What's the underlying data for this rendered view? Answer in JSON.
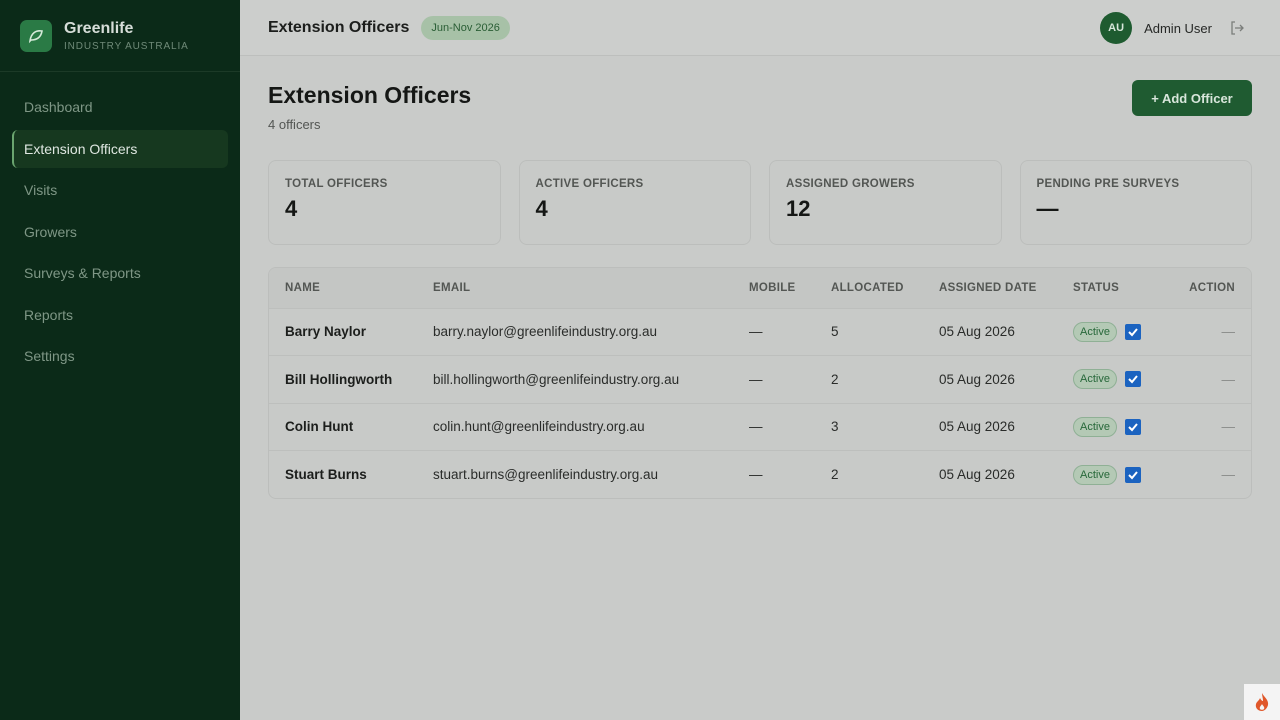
{
  "brand": {
    "name": "Greenlife",
    "subtitle": "INDUSTRY AUSTRALIA"
  },
  "sidebar": {
    "items": [
      {
        "label": "Dashboard"
      },
      {
        "label": "Extension Officers"
      },
      {
        "label": "Visits"
      },
      {
        "label": "Growers"
      },
      {
        "label": "Surveys & Reports"
      },
      {
        "label": "Reports"
      },
      {
        "label": "Settings"
      }
    ]
  },
  "header": {
    "title": "Extension Officers",
    "season": "Jun-Nov 2026"
  },
  "user": {
    "initials": "AU",
    "name": "Admin User"
  },
  "page": {
    "title": "Extension Officers",
    "subtitle": "4 officers",
    "add_button": "+ Add Officer"
  },
  "stats": [
    {
      "label": "TOTAL OFFICERS",
      "value": "4"
    },
    {
      "label": "ACTIVE OFFICERS",
      "value": "4"
    },
    {
      "label": "ASSIGNED GROWERS",
      "value": "12"
    },
    {
      "label": "PENDING PRE SURVEYS",
      "value": "—"
    }
  ],
  "table": {
    "headers": [
      "NAME",
      "EMAIL",
      "MOBILE",
      "ALLOCATED",
      "ASSIGNED DATE",
      "STATUS",
      "ACTION"
    ],
    "rows": [
      {
        "name": "Barry Naylor",
        "email": "barry.naylor@greenlifeindustry.org.au",
        "mobile": "—",
        "allocated": "5",
        "date": "05 Aug 2026",
        "status": "Active",
        "action": "—"
      },
      {
        "name": "Bill Hollingworth",
        "email": "bill.hollingworth@greenlifeindustry.org.au",
        "mobile": "—",
        "allocated": "2",
        "date": "05 Aug 2026",
        "status": "Active",
        "action": "—"
      },
      {
        "name": "Colin Hunt",
        "email": "colin.hunt@greenlifeindustry.org.au",
        "mobile": "—",
        "allocated": "3",
        "date": "05 Aug 2026",
        "status": "Active",
        "action": "—"
      },
      {
        "name": "Stuart Burns",
        "email": "stuart.burns@greenlifeindustry.org.au",
        "mobile": "—",
        "allocated": "2",
        "date": "05 Aug 2026",
        "status": "Active",
        "action": "—"
      }
    ]
  },
  "icons": {
    "logo": "leaf-icon",
    "logout": "logout-icon",
    "checkbox": "checkbox-checked-icon",
    "corner": "flame-icon"
  },
  "colors": {
    "sidebar": "#0b2a18",
    "accent": "#1f5b31",
    "checkbox": "#1b63c0"
  }
}
